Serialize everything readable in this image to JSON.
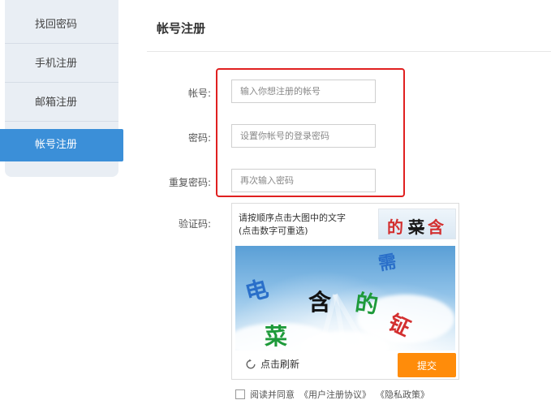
{
  "sidebar": {
    "items": [
      {
        "label": "找回密码",
        "active": false
      },
      {
        "label": "手机注册",
        "active": false
      },
      {
        "label": "邮箱注册",
        "active": false
      },
      {
        "label": "帐号注册",
        "active": true
      }
    ]
  },
  "main": {
    "title": "帐号注册",
    "fields": [
      {
        "label": "帐号:",
        "placeholder": "输入你想注册的帐号"
      },
      {
        "label": "密码:",
        "placeholder": "设置你帐号的登录密码"
      },
      {
        "label": "重复密码:",
        "placeholder": "再次输入密码"
      }
    ],
    "captcha": {
      "label": "验证码:",
      "instruction_line1": "请按顺序点击大图中的文字",
      "instruction_line2": "(点击数字可重选)",
      "target_chars": [
        "的",
        "菜",
        "含"
      ],
      "image_chars": [
        {
          "char": "电",
          "color": "#2a6fc9"
        },
        {
          "char": "含",
          "color": "#111111"
        },
        {
          "char": "的",
          "color": "#1e9a3a"
        },
        {
          "char": "菜",
          "color": "#1e9a3a"
        },
        {
          "char": "需",
          "color": "#2a6fc9"
        },
        {
          "char": "钲",
          "color": "#d33030"
        }
      ],
      "refresh_label": "点击刷新",
      "submit_label": "提交"
    },
    "agree": {
      "prefix": "阅读并同意",
      "terms": "《用户注册协议》",
      "privacy": "《隐私政策》"
    }
  },
  "colors": {
    "accent": "#3b8fd8",
    "submit": "#ff8c0a",
    "highlight_box": "#e02020"
  }
}
